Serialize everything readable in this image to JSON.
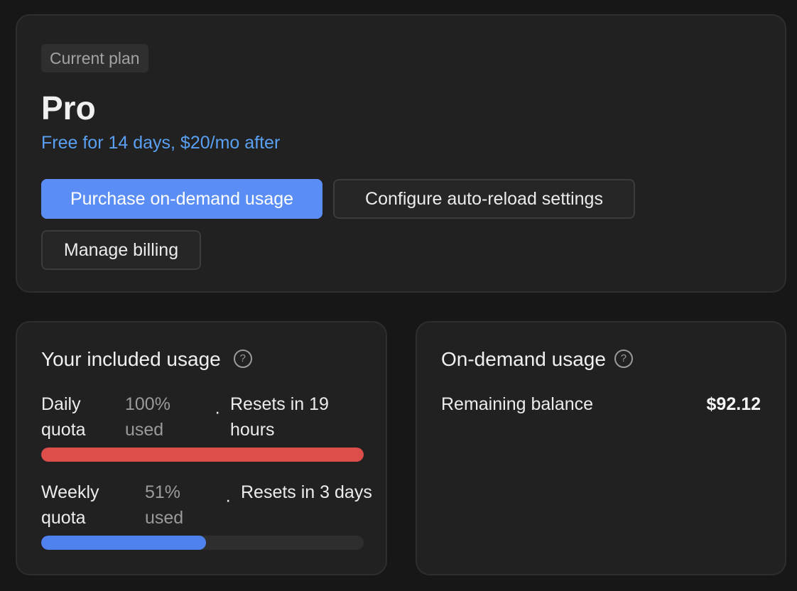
{
  "plan": {
    "badge": "Current plan",
    "name": "Pro",
    "subtitle": "Free for 14 days, $20/mo after",
    "buttons": {
      "purchase": "Purchase on-demand usage",
      "configure": "Configure auto-reload settings",
      "manage": "Manage billing"
    }
  },
  "included_usage": {
    "title": "Your included usage",
    "help_icon": "question-circle-icon",
    "daily": {
      "label": "Daily quota",
      "used": "100% used",
      "separator": "·",
      "reset": "Resets in 19 hours",
      "percent": 100,
      "color": "#dd4e4b"
    },
    "weekly": {
      "label": "Weekly quota",
      "used": "51% used",
      "separator": "·",
      "reset": "Resets in 3 days",
      "percent": 51,
      "color": "#4f82ee"
    }
  },
  "ondemand_usage": {
    "title": "On-demand usage",
    "help_icon": "question-circle-icon",
    "balance_label": "Remaining balance",
    "balance_value": "$92.12"
  },
  "colors": {
    "accent": "#5b8ef5",
    "link": "#5aa0f2",
    "background": "#171717",
    "card": "#212121"
  }
}
